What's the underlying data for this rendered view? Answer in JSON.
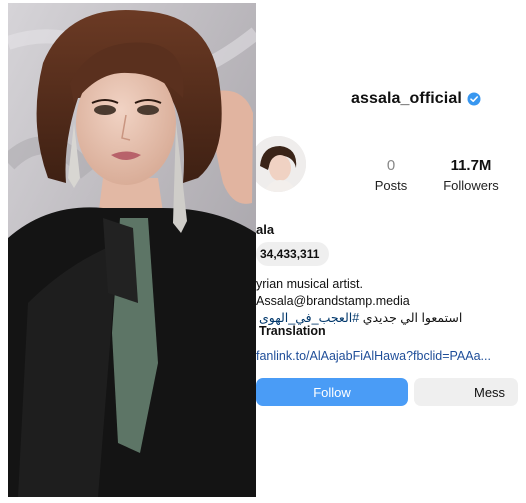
{
  "profile": {
    "username": "assala_official",
    "verified": true,
    "stats": {
      "posts_value": "0",
      "posts_label": "Posts",
      "followers_value": "11.7M",
      "followers_label": "Followers"
    },
    "display_name": "ala",
    "threads_count": "34,433,311",
    "bio": {
      "category": "yrian musical artist.",
      "email": "Assala@brandstamp.media",
      "arabic_text": "استمعوا الي جديدي",
      "hashtag": "#العجب_في_الهوى",
      "translation_label": "Translation"
    },
    "link_text": "fanlink.to/AlAajabFiAlHawa?fbclid=PAAa...",
    "buttons": {
      "follow": "Follow",
      "message": "Mess"
    }
  },
  "colors": {
    "follow_blue": "#4a9cf6",
    "verified_blue": "#3897f0",
    "link_blue": "#1f4e99",
    "button_gray": "#efefef"
  },
  "icons": {
    "verified": "verified-badge-icon"
  }
}
